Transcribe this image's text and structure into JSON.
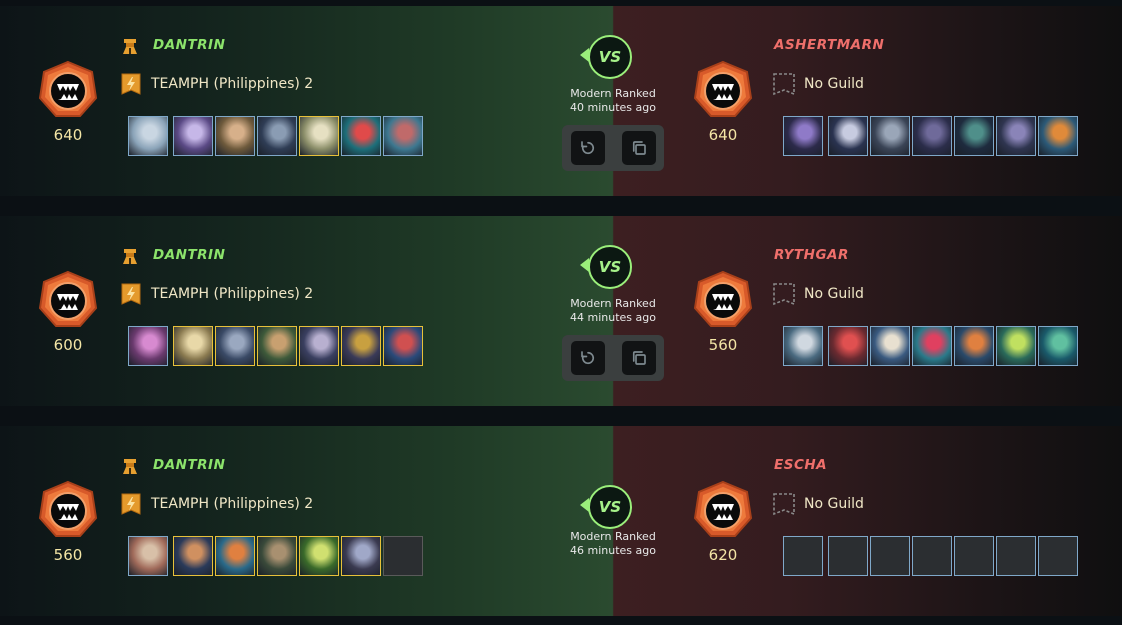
{
  "colors": {
    "player_name": "#8ce36b",
    "opponent_name": "#ef6f6b",
    "rating": "#f4e6a6",
    "vs_accent": "#9bef7b",
    "card_border_blue": "#7fa8c9",
    "card_border_gold": "#e7c13a"
  },
  "battles": [
    {
      "player": {
        "name": "DANTRIN",
        "guild": "TEAMPH (Philippines) 2",
        "rating": "640",
        "cards": [
          {
            "color": "#8aa3b8",
            "accent": "#c9d6e2",
            "border": "blue"
          },
          {
            "color": "#5b4a86",
            "accent": "#c6b7e8",
            "border": "blue"
          },
          {
            "color": "#6e5a3c",
            "accent": "#d7b08a",
            "border": "blue"
          },
          {
            "color": "#2f3d55",
            "accent": "#8a9cb3",
            "border": "blue"
          },
          {
            "color": "#8c8f6a",
            "accent": "#e6e0c2",
            "border": "gold"
          },
          {
            "color": "#1d6f7a",
            "accent": "#e04a4a",
            "border": "blue"
          },
          {
            "color": "#3d7890",
            "accent": "#c06a6a",
            "border": "blue"
          }
        ]
      },
      "mode": "Modern Ranked",
      "time": "40 minutes ago",
      "has_actions": true,
      "opponent": {
        "name": "ASHERTMARN",
        "guild": "No Guild",
        "rating": "640",
        "cards": [
          {
            "color": "#2c2a4a",
            "accent": "#8f7ac8",
            "border": "blue"
          },
          {
            "color": "#2a3350",
            "accent": "#c7cbe0",
            "border": "blue"
          },
          {
            "color": "#3a4456",
            "accent": "#9aa6b8",
            "border": "blue"
          },
          {
            "color": "#2b2d4a",
            "accent": "#6f6a9a",
            "border": "blue"
          },
          {
            "color": "#1e2b3e",
            "accent": "#4f8f8a",
            "border": "blue"
          },
          {
            "color": "#2f3550",
            "accent": "#8a84b8",
            "border": "blue"
          },
          {
            "color": "#2c5a78",
            "accent": "#e08a3a",
            "border": "blue"
          }
        ]
      }
    },
    {
      "player": {
        "name": "DANTRIN",
        "guild": "TEAMPH (Philippines) 2",
        "rating": "600",
        "cards": [
          {
            "color": "#6a3a6e",
            "accent": "#d78ad0",
            "border": "blue"
          },
          {
            "color": "#8a7a50",
            "accent": "#e8d8a8",
            "border": "gold"
          },
          {
            "color": "#3a4a66",
            "accent": "#9aa8c0",
            "border": "gold"
          },
          {
            "color": "#3e5a3a",
            "accent": "#c8a070",
            "border": "gold"
          },
          {
            "color": "#3a3f60",
            "accent": "#b8b0d0",
            "border": "gold"
          },
          {
            "color": "#3a3a58",
            "accent": "#c8a040",
            "border": "gold"
          },
          {
            "color": "#2a4a7a",
            "accent": "#d05050",
            "border": "gold"
          }
        ]
      },
      "mode": "Modern Ranked",
      "time": "44 minutes ago",
      "has_actions": true,
      "opponent": {
        "name": "RYTHGAR",
        "guild": "No Guild",
        "rating": "560",
        "cards": [
          {
            "color": "#4a6a80",
            "accent": "#d0d8e0",
            "border": "blue"
          },
          {
            "color": "#6a2a30",
            "accent": "#e05050",
            "border": "blue"
          },
          {
            "color": "#3a5a80",
            "accent": "#e8e0d0",
            "border": "blue"
          },
          {
            "color": "#2a7a8a",
            "accent": "#e04060",
            "border": "blue"
          },
          {
            "color": "#2a4a6a",
            "accent": "#e08040",
            "border": "blue"
          },
          {
            "color": "#2a6a5a",
            "accent": "#c0e060",
            "border": "blue"
          },
          {
            "color": "#1a5a6a",
            "accent": "#60c0a0",
            "border": "blue"
          }
        ]
      }
    },
    {
      "player": {
        "name": "DANTRIN",
        "guild": "TEAMPH (Philippines) 2",
        "rating": "560",
        "cards": [
          {
            "color": "#a06a5a",
            "accent": "#d8c0a8",
            "border": "blue"
          },
          {
            "color": "#2a3a5a",
            "accent": "#d09060",
            "border": "gold"
          },
          {
            "color": "#2a6a8a",
            "accent": "#e08040",
            "border": "gold"
          },
          {
            "color": "#3a4a3a",
            "accent": "#a89070",
            "border": "gold"
          },
          {
            "color": "#3a6a2a",
            "accent": "#d0e070",
            "border": "gold"
          },
          {
            "color": "#3a3a50",
            "accent": "#a0a8c8",
            "border": "gold"
          },
          {
            "color": "",
            "accent": "",
            "border": "empty"
          }
        ]
      },
      "mode": "Modern Ranked",
      "time": "46 minutes ago",
      "has_actions": false,
      "opponent": {
        "name": "ESCHA",
        "guild": "No Guild",
        "rating": "620",
        "cards": [
          {
            "color": "",
            "accent": "",
            "border": "empty-blue"
          },
          {
            "color": "",
            "accent": "",
            "border": "empty-blue"
          },
          {
            "color": "",
            "accent": "",
            "border": "empty-blue"
          },
          {
            "color": "",
            "accent": "",
            "border": "empty-blue"
          },
          {
            "color": "",
            "accent": "",
            "border": "empty-blue"
          },
          {
            "color": "",
            "accent": "",
            "border": "empty-blue"
          },
          {
            "color": "",
            "accent": "",
            "border": "empty-blue"
          }
        ]
      }
    }
  ]
}
